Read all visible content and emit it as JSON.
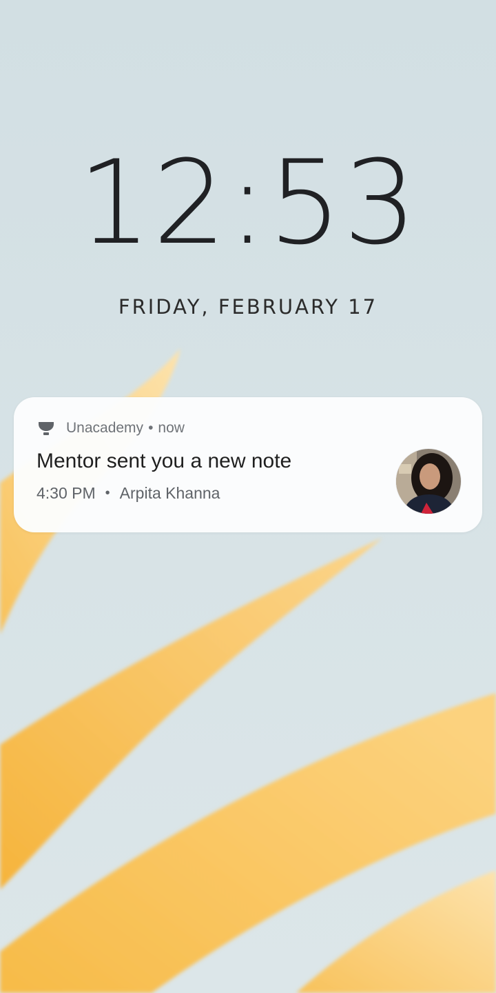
{
  "lockscreen": {
    "time": "12:53",
    "date": "FRIDAY, FEBRUARY 17"
  },
  "notification": {
    "app_icon": "unacademy-logo-icon",
    "app_name": "Unacademy",
    "separator": "•",
    "time": "now",
    "title": "Mentor sent you a new note",
    "sub_time": "4:30 PM",
    "sub_separator": "•",
    "sender": "Arpita Khanna",
    "avatar": "person-avatar"
  },
  "colors": {
    "wallpaper_background": "#d6e2e6",
    "petal": "#f7b733",
    "clock_text": "#202124"
  }
}
